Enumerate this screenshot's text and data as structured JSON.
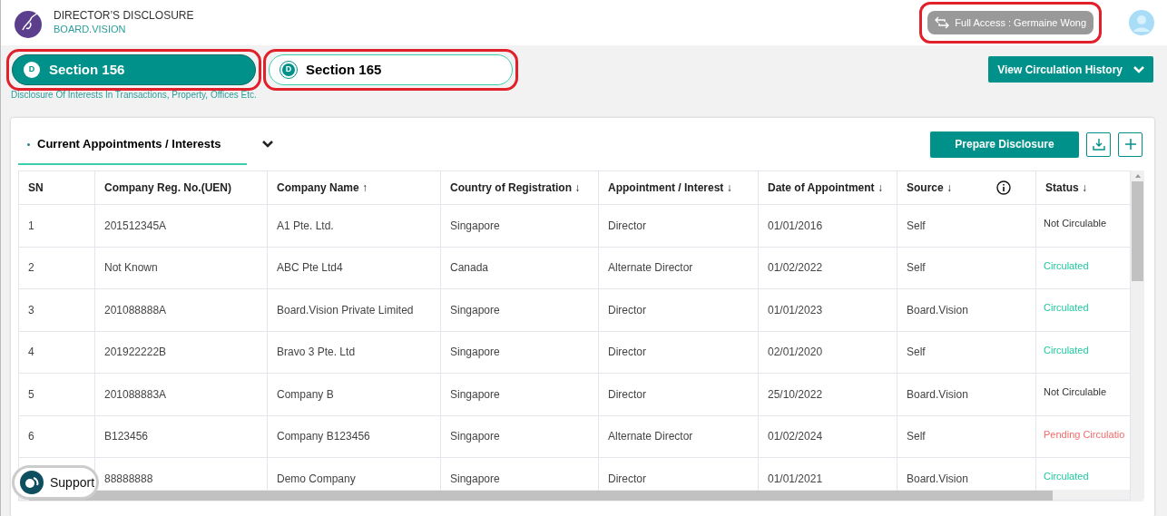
{
  "app": {
    "title": "DIRECTOR’S DISCLOSURE",
    "subtitle": "BOARD.VISION"
  },
  "user_chip": {
    "label": "Full Access : Germaine Wong",
    "highlighted": true
  },
  "section_tabs": [
    {
      "badge": "D",
      "label": "Section 156",
      "selected": true,
      "highlighted": true
    },
    {
      "badge": "D",
      "label": "Section 165",
      "selected": false,
      "highlighted": true
    }
  ],
  "section_description": "Disclosure Of Interests In Transactions, Property, Offices Etc.",
  "history_button": "View Circulation History",
  "card": {
    "tab": "Current Appointments / Interests",
    "prepare_button": "Prepare Disclosure"
  },
  "table": {
    "columns": [
      "SN",
      "Company Reg. No.(UEN)",
      "Company Name ↑",
      "Country of Registration ↓",
      "Appointment / Interest ↓",
      "Date of Appointment ↓",
      "Source ↓",
      "Status ↓"
    ],
    "rows": [
      {
        "cells": [
          "1",
          "201512345A",
          "A1 Pte. Ltd.",
          "Singapore",
          "Director",
          "01/01/2016",
          "Self"
        ],
        "status": "Not Circulable",
        "kind": "not_circulable"
      },
      {
        "cells": [
          "2",
          "Not Known",
          "ABC Pte Ltd4",
          "Canada",
          "Alternate Director",
          "01/02/2022",
          "Self"
        ],
        "status": "Circulated",
        "kind": "circulated"
      },
      {
        "cells": [
          "3",
          "201088888A",
          "Board.Vision Private Limited",
          "Singapore",
          "Director",
          "01/01/2023",
          "Board.Vision"
        ],
        "status": "Circulated",
        "kind": "circulated"
      },
      {
        "cells": [
          "4",
          "201922222B",
          "Bravo 3 Pte. Ltd",
          "Singapore",
          "Director",
          "02/01/2020",
          "Self"
        ],
        "status": "Circulated",
        "kind": "circulated"
      },
      {
        "cells": [
          "5",
          "201088883A",
          "Company B",
          "Singapore",
          "Director",
          "25/10/2022",
          "Board.Vision"
        ],
        "status": "Not Circulable",
        "kind": "not_circulable"
      },
      {
        "cells": [
          "6",
          "B123456",
          "Company B123456",
          "Singapore",
          "Alternate Director",
          "01/02/2024",
          "Self"
        ],
        "status": "Pending Circulatio",
        "kind": "pending"
      },
      {
        "cells": [
          "",
          "88888888",
          "Demo Company",
          "Singapore",
          "Director",
          "01/01/2021",
          "Board.Vision"
        ],
        "status": "Circulated",
        "kind": "circulated"
      }
    ]
  },
  "support_button": "Support"
}
